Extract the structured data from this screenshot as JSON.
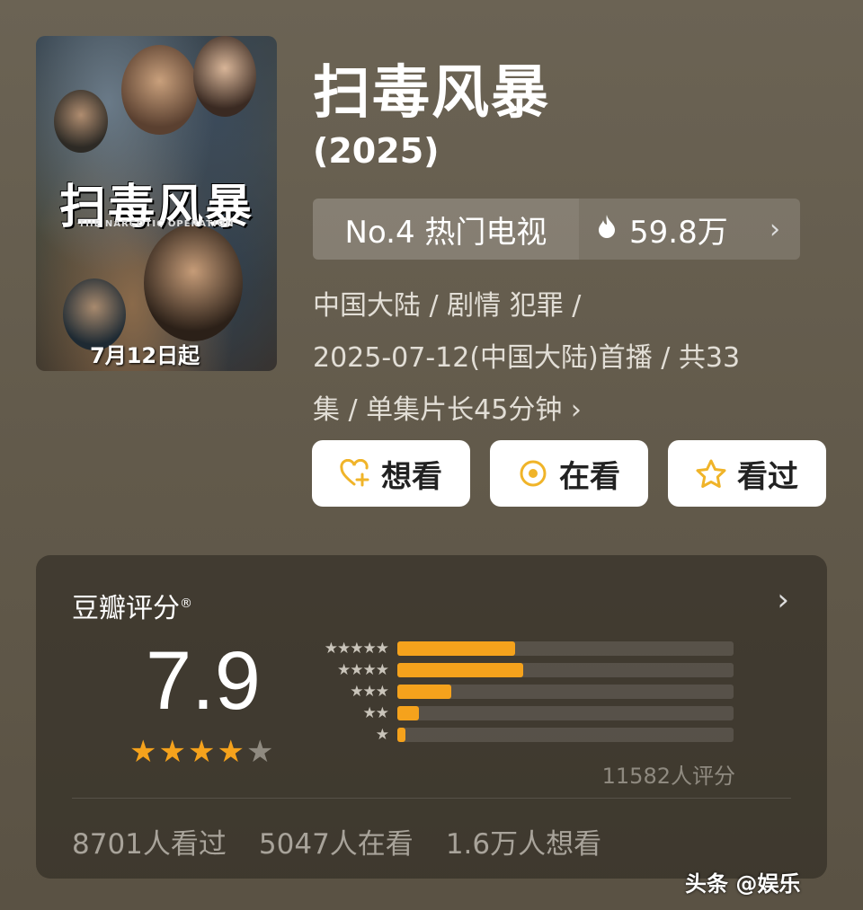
{
  "poster": {
    "title": "扫毒风暴",
    "subtitle": "THE NARCOTIC OPERATION",
    "date": "7月12日起"
  },
  "show": {
    "title": "扫毒风暴",
    "year": "(2025)"
  },
  "rank": {
    "label": "No.4 热门电视",
    "heat": "59.8万",
    "icon": "flame-icon"
  },
  "meta": {
    "line1": "中国大陆 / 剧情 犯罪 /",
    "line2": "2025-07-12(中国大陆)首播 / 共33",
    "line3": "集 / 单集片长45分钟 ›"
  },
  "actions": [
    {
      "label": "想看",
      "icon": "heart-plus-icon"
    },
    {
      "label": "在看",
      "icon": "circle-dot-icon"
    },
    {
      "label": "看过",
      "icon": "star-outline-icon"
    }
  ],
  "rating": {
    "title": "豆瓣评分",
    "reg_mark": "®",
    "score": "7.9",
    "stars_filled": 4,
    "stars_total": 5,
    "distribution": [
      {
        "stars": "★★★★★",
        "fraction": 0.35
      },
      {
        "stars": "★★★★",
        "fraction": 0.375
      },
      {
        "stars": "★★★",
        "fraction": 0.16
      },
      {
        "stars": "★★",
        "fraction": 0.065
      },
      {
        "stars": "★",
        "fraction": 0.025
      }
    ],
    "count": "11582人评分"
  },
  "stats": {
    "watched": "8701人看过",
    "watching": "5047人在看",
    "want": "1.6万人想看"
  },
  "watermark": "头条 @娱乐",
  "colors": {
    "accent": "#f5a21c",
    "background": "#645c4d",
    "icon_accent": "#f0b429"
  }
}
